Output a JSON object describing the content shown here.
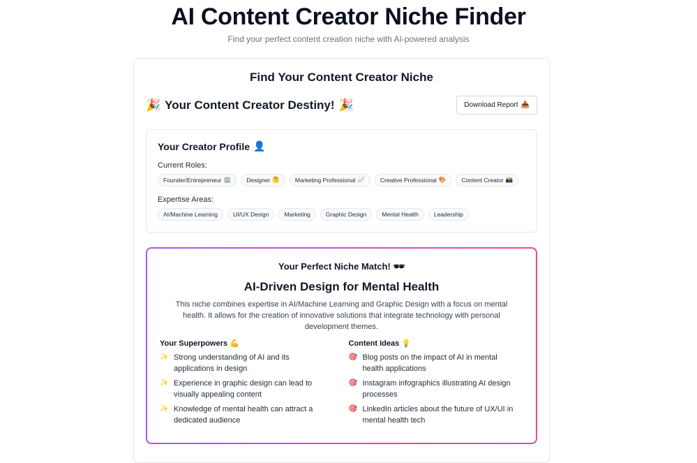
{
  "header": {
    "title": "AI Content Creator Niche Finder",
    "subtitle": "Find your perfect content creation niche with AI-powered analysis"
  },
  "card": {
    "title": "Find Your Content Creator Niche"
  },
  "destiny": {
    "icon_left": "🎉",
    "title": "Your Content Creator Destiny!",
    "icon_right": "🎉",
    "download_label": "Download Report",
    "download_icon": "📥"
  },
  "profile": {
    "title": "Your Creator Profile",
    "title_icon": "👤",
    "roles_label": "Current Roles:",
    "roles": [
      {
        "label": "Founder/Entrepreneur",
        "icon": "🏢"
      },
      {
        "label": "Designer",
        "icon": "🤔"
      },
      {
        "label": "Marketing Professional",
        "icon": "📈"
      },
      {
        "label": "Creative Professional",
        "icon": "🎨"
      },
      {
        "label": "Content Creator",
        "icon": "📸"
      }
    ],
    "expertise_label": "Expertise Areas:",
    "expertise": [
      "AI/Machine Learning",
      "UI/UX Design",
      "Marketing",
      "Graphic Design",
      "Mental Health",
      "Leadership"
    ]
  },
  "niche": {
    "match_title": "Your Perfect Niche Match!",
    "match_icon": "🕶",
    "name": "AI-Driven Design for Mental Health",
    "description": "This niche combines expertise in AI/Machine Learning and Graphic Design with a focus on mental health. It allows for the creation of innovative solutions that integrate technology with personal development themes.",
    "superpowers_title": "Your Superpowers",
    "superpowers_icon": "💪",
    "superpowers_bullet": "✨",
    "superpowers": [
      "Strong understanding of AI and its applications in design",
      "Experience in graphic design can lead to visually appealing content",
      "Knowledge of mental health can attract a dedicated audience"
    ],
    "ideas_title": "Content Ideas",
    "ideas_icon": "💡",
    "ideas_bullet": "🎯",
    "ideas": [
      "Blog posts on the impact of AI in mental health applications",
      "Instagram infographics illustrating AI design processes",
      "LinkedIn articles about the future of UX/UI in mental health tech"
    ]
  }
}
